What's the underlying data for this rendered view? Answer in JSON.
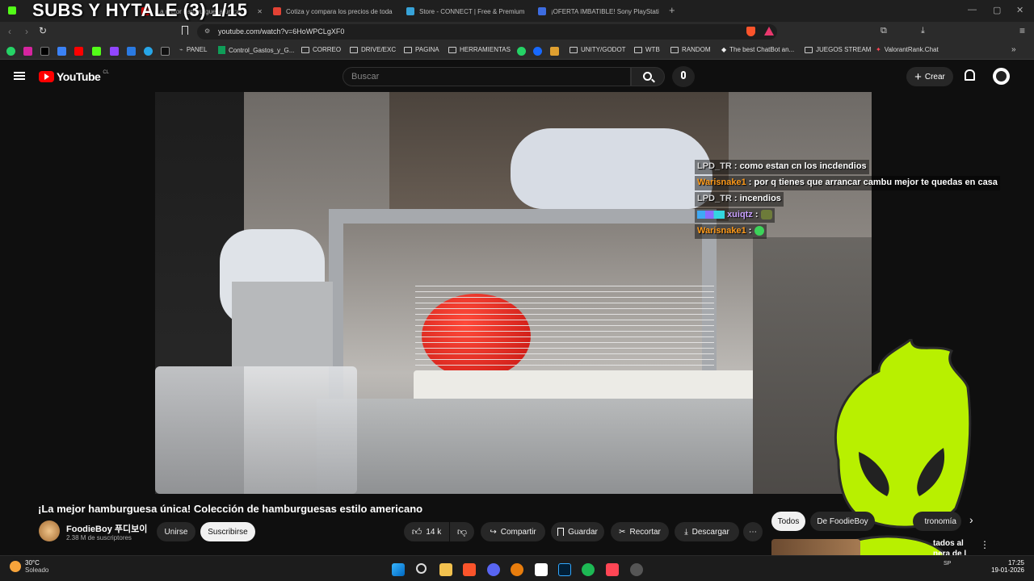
{
  "overlay_title": "SUBS Y HYTALE (3) 1/15",
  "tabs": [
    {
      "label": "¡La mejor hamburguesa única!",
      "color": "#ff0000"
    },
    {
      "label": "Cotiza y compara los precios de toda",
      "color": "#e34234"
    },
    {
      "label": "Store - CONNECT | Free & Premium",
      "color": "#37a3d8"
    },
    {
      "label": "¡OFERTA IMBATIBLE! Sony PlayStation",
      "color": "#3d6ce0"
    }
  ],
  "new_tab": "+",
  "window_controls": {
    "minimize": "—",
    "maximize": "▢",
    "close": "✕"
  },
  "address": {
    "url": "youtube.com/watch?v=6HoWPCLgXF0"
  },
  "bookmarks": [
    {
      "label": "PANEL",
      "type": "link"
    },
    {
      "label": "Control_Gastos_y_G...",
      "type": "sheet"
    },
    {
      "label": "CORREO",
      "type": "folder"
    },
    {
      "label": "DRIVE/EXC",
      "type": "folder"
    },
    {
      "label": "PAGINA",
      "type": "folder"
    },
    {
      "label": "HERRAMIENTAS",
      "type": "folder"
    },
    {
      "label": "UNITY/GODOT",
      "type": "folder"
    },
    {
      "label": "WTB",
      "type": "folder"
    },
    {
      "label": "RANDOM",
      "type": "folder"
    },
    {
      "label": "The best ChatBot an...",
      "type": "link"
    },
    {
      "label": "JUEGOS STREAM",
      "type": "folder"
    },
    {
      "label": "ValorantRank.Chat",
      "type": "link"
    }
  ],
  "youtube": {
    "logo_text": "YouTube",
    "region": "CL",
    "search_placeholder": "Buscar",
    "create_label": "Crear"
  },
  "chat": [
    {
      "user": "LPD_TR",
      "user_color": "#d8d8d8",
      "message": "como estan cn los incdendios"
    },
    {
      "user": "Warisnake1",
      "user_color": "#ff9b1a",
      "message": "por q tienes que arrancar cambu mejor te quedas en casa"
    },
    {
      "user": "LPD_TR",
      "user_color": "#d8d8d8",
      "message": "incendios"
    },
    {
      "user": "xuiqtz",
      "user_color": "#c9a0ff",
      "message": ""
    },
    {
      "user": "Warisnake1",
      "user_color": "#ff9b1a",
      "message": ""
    }
  ],
  "video": {
    "title": "¡La mejor hamburguesa única! Colección de hamburguesas estilo americano",
    "channel": "FoodieBoy 푸디보이",
    "subscribers": "2.38 M de suscriptores",
    "join_label": "Unirse",
    "subscribe_label": "Suscribirse",
    "likes": "14 k",
    "share_label": "Compartir",
    "save_label": "Guardar",
    "clip_label": "Recortar",
    "download_label": "Descargar"
  },
  "side_filters": [
    "Todos",
    "De FoodieBoy",
    "tronomía"
  ],
  "side_partial_text": "tados al",
  "side_partial_text2": "nera de l",
  "taskbar": {
    "weather_temp": "30°C",
    "weather_desc": "Soleado",
    "time": "17:25",
    "date": "19-01-2026",
    "lang": "SP"
  },
  "colors": {
    "accent_green": "#b8f000",
    "youtube_red": "#ff0000"
  }
}
